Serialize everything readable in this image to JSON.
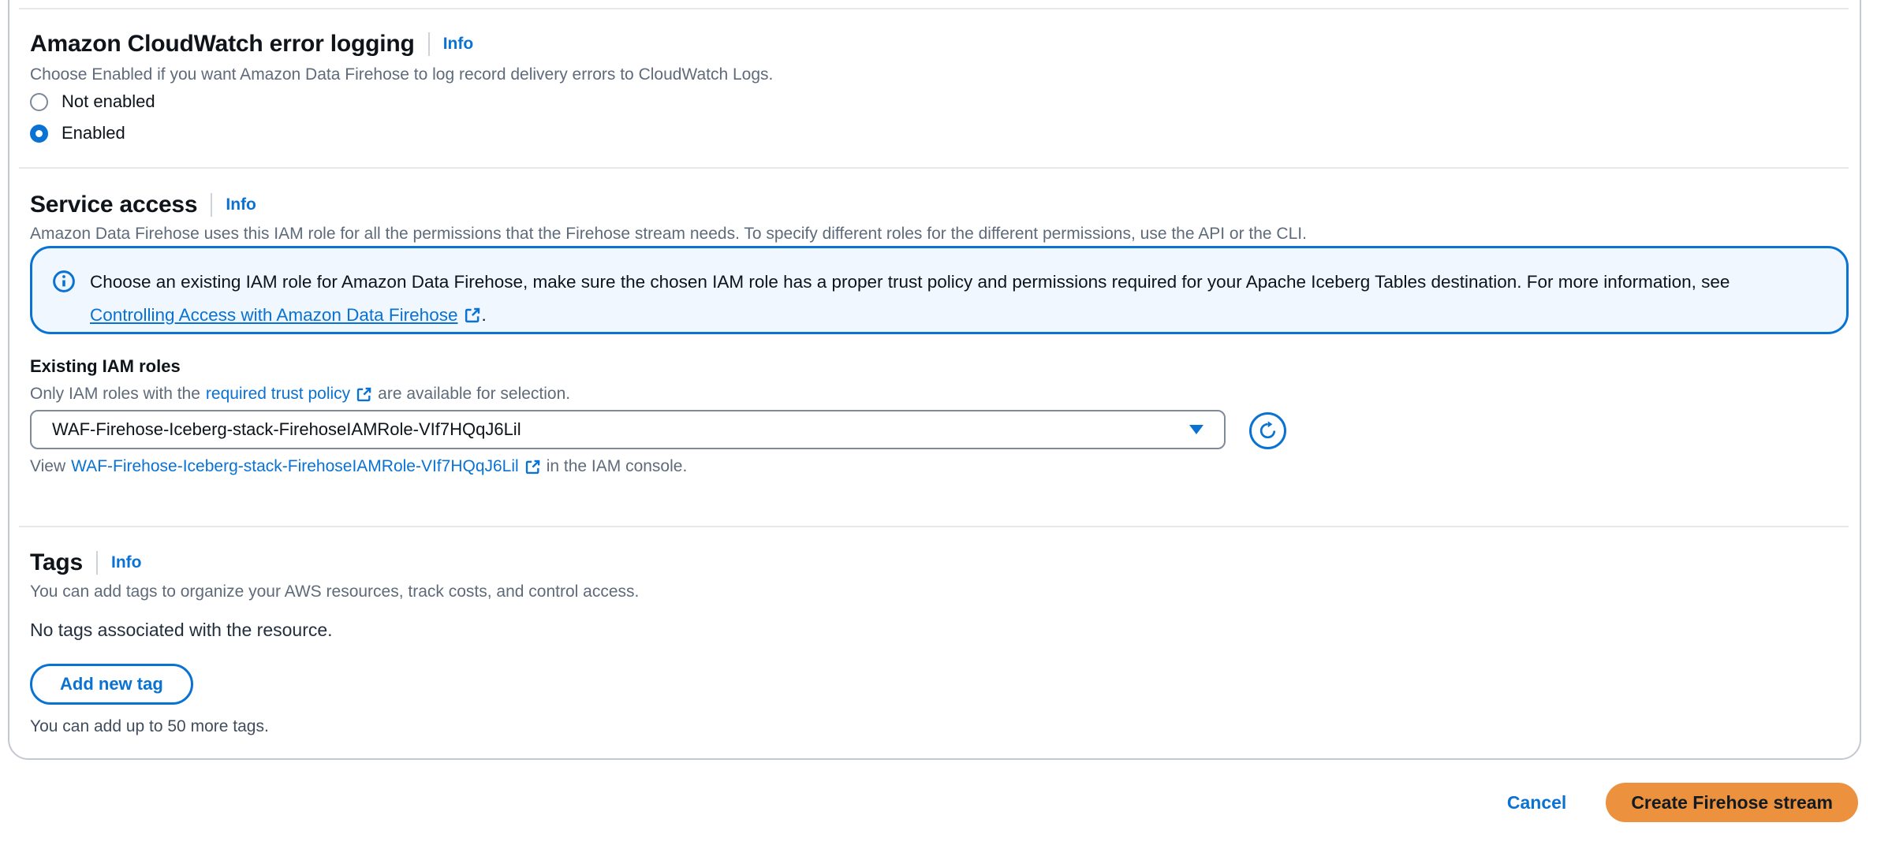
{
  "colors": {
    "accent_blue": "#0972d3",
    "primary_button_bg": "#ec913d",
    "primary_button_text": "#131a22",
    "alert_bg": "#f0f7ff",
    "alert_border": "#0972d3",
    "heading_text": "#0f141a",
    "muted_text": "#5f6b7a",
    "card_border": "#c3c9d1",
    "divider": "#e6e9ec"
  },
  "icons": {
    "info_circle": "info-circle",
    "external_link": "external-link",
    "refresh": "refresh",
    "dropdown_caret": "caret-down",
    "radio": "radio-button"
  },
  "cloudwatch": {
    "title": "Amazon CloudWatch error logging",
    "info_label": "Info",
    "description": "Choose Enabled if you want Amazon Data Firehose to log record delivery errors to CloudWatch Logs.",
    "options": [
      {
        "label": "Not enabled",
        "selected": false
      },
      {
        "label": "Enabled",
        "selected": true
      }
    ]
  },
  "service_access": {
    "title": "Service access",
    "info_label": "Info",
    "description": "Amazon Data Firehose uses this IAM role for all the permissions that the Firehose stream needs. To specify different roles for the different permissions, use the API or the CLI.",
    "alert": {
      "line1": "Choose an existing IAM role for Amazon Data Firehose, make sure the chosen IAM role has a proper trust policy and permissions required for your Apache Iceberg Tables destination. For more information, see",
      "link_label": "Controlling Access with Amazon Data Firehose",
      "after_link": "."
    },
    "existing_roles": {
      "label": "Existing IAM roles",
      "desc_prefix": "Only IAM roles with the",
      "trust_policy_link_label": "required trust policy",
      "desc_suffix": "are available for selection.",
      "selected_role": "WAF-Firehose-Iceberg-stack-FirehoseIAMRole-VIf7HQqJ6Lil",
      "view_prefix": "View",
      "view_link_label": "WAF-Firehose-Iceberg-stack-FirehoseIAMRole-VIf7HQqJ6Lil",
      "view_suffix": "in the IAM console."
    }
  },
  "tags": {
    "title": "Tags",
    "info_label": "Info",
    "description": "You can add tags to organize your AWS resources, track costs, and control access.",
    "empty_message": "No tags associated with the resource.",
    "add_button_label": "Add new tag",
    "limit_message": "You can add up to 50 more tags."
  },
  "footer": {
    "cancel_label": "Cancel",
    "create_label": "Create Firehose stream"
  }
}
